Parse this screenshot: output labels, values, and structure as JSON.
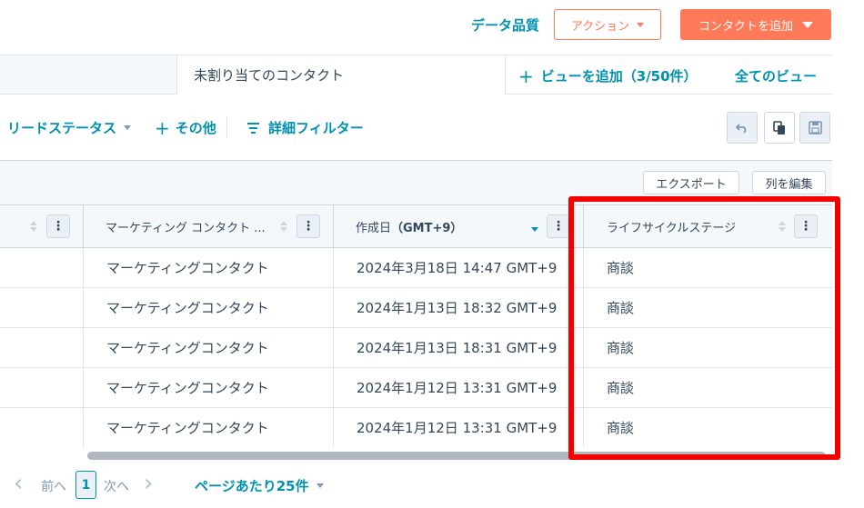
{
  "header": {
    "data_quality": "データ品質",
    "action_label": "アクション",
    "add_contact_label": "コンタクトを追加"
  },
  "views": {
    "active_tab": "未割り当てのコンタクト",
    "add_view": "ビューを追加（3/50件）",
    "all_views": "全てのビュー"
  },
  "filters": {
    "lead_status": "リードステータス",
    "more": "その他",
    "advanced": "詳細フィルター"
  },
  "table_toolbar": {
    "export": "エクスポート",
    "edit_columns": "列を編集"
  },
  "columns": [
    {
      "label": "マーケティング コンタクト ..."
    },
    {
      "label": "作成日",
      "suffix": "（GMT+9）"
    },
    {
      "label": "ライフサイクルステージ"
    }
  ],
  "rows": [
    {
      "marketing": "マーケティングコンタクト",
      "created": "2024年3月18日 14:47 GMT+9",
      "stage": "商談"
    },
    {
      "marketing": "マーケティングコンタクト",
      "created": "2024年1月13日 18:32 GMT+9",
      "stage": "商談"
    },
    {
      "marketing": "マーケティングコンタクト",
      "created": "2024年1月13日 18:31 GMT+9",
      "stage": "商談"
    },
    {
      "marketing": "マーケティングコンタクト",
      "created": "2024年1月12日 13:31 GMT+9",
      "stage": "商談"
    },
    {
      "marketing": "マーケティングコンタクト",
      "created": "2024年1月12日 13:31 GMT+9",
      "stage": "商談"
    }
  ],
  "pager": {
    "prev": "前へ",
    "current_page": "1",
    "next": "次へ",
    "per_page": "ページあたり25件"
  },
  "icons": {
    "undo": "undo-icon",
    "copy": "copy-icon",
    "save": "save-icon"
  },
  "colors": {
    "accent_orange": "#ff7a59",
    "link_teal": "#0091ae",
    "highlight_red": "#f40000"
  }
}
